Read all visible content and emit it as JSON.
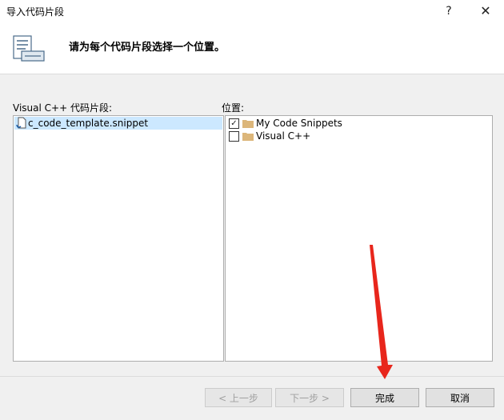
{
  "window": {
    "title": "导入代码片段",
    "help_label": "?",
    "close_label": "✕"
  },
  "header": {
    "instruction": "请为每个代码片段选择一个位置。"
  },
  "left_panel": {
    "label": "Visual C++ 代码片段:",
    "items": [
      {
        "label": "c_code_template.snippet",
        "selected": true
      }
    ]
  },
  "right_panel": {
    "label": "位置:",
    "items": [
      {
        "label": "My Code Snippets",
        "checked": true,
        "check_glyph": "✓"
      },
      {
        "label": "Visual C++",
        "checked": false,
        "check_glyph": ""
      }
    ]
  },
  "buttons": {
    "prev": "< 上一步",
    "next": "下一步 >",
    "finish": "完成",
    "cancel": "取消"
  },
  "colors": {
    "selection": "#cce8ff",
    "annotation_arrow": "#e8261c",
    "folder": "#dcb67a"
  }
}
